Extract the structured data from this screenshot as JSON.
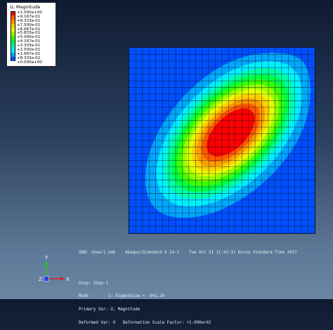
{
  "legend": {
    "title": "U, Magnitude",
    "labels": [
      "+1.000e+00",
      "+9.167e-01",
      "+8.333e-01",
      "+7.500e-01",
      "+6.667e-01",
      "+5.833e-01",
      "+5.000e-01",
      "+4.167e-01",
      "+3.333e-01",
      "+2.500e-01",
      "+1.667e-01",
      "+8.333e-02",
      "+0.000e+00"
    ],
    "colors": [
      "#ff0000",
      "#ff5a00",
      "#ff9a00",
      "#ffd000",
      "#e6ff00",
      "#9aff00",
      "#3cff00",
      "#00ff46",
      "#00ffa8",
      "#00f0ff",
      "#00a8ff",
      "#0050ff",
      "#0000ff"
    ]
  },
  "viewport": {
    "info_line": "ODB: shear1.odb    Abaqus/Standard 6.14-2    Tue Oct 31 11:42:31 Korea Standard Time 2017",
    "status_lines": [
      "Step: Step-1",
      "Mode        1: EigenValue = -942.20",
      "Primary Var: U, Magnitude",
      "Deformed Var: U   Deformation Scale Factor: +1.000e+02"
    ]
  },
  "triad": {
    "y": "Y",
    "x": "X",
    "z": "Z"
  },
  "mesh": {
    "elements_per_side": 28
  }
}
